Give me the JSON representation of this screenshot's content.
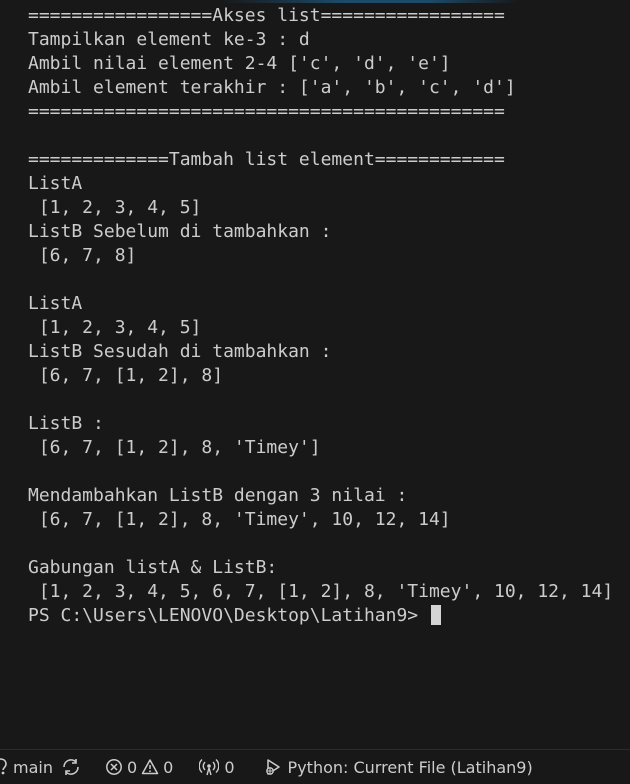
{
  "terminal": {
    "lines": [
      "=================Akses list=================",
      "Tampilkan element ke-3 : d",
      "Ambil nilai element 2-4 ['c', 'd', 'e']",
      "Ambil element terakhir : ['a', 'b', 'c', 'd']",
      "============================================",
      "",
      "=============Tambah list element============",
      "ListA",
      " [1, 2, 3, 4, 5]",
      "ListB Sebelum di tambahkan :",
      " [6, 7, 8]",
      "",
      "ListA",
      " [1, 2, 3, 4, 5]",
      "ListB Sesudah di tambahkan :",
      " [6, 7, [1, 2], 8]",
      "",
      "ListB :",
      " [6, 7, [1, 2], 8, 'Timey']",
      "",
      "Mendambahkan ListB dengan 3 nilai :",
      " [6, 7, [1, 2], 8, 'Timey', 10, 12, 14]",
      "",
      "Gabungan listA & ListB:",
      " [1, 2, 3, 4, 5, 6, 7, [1, 2], 8, 'Timey', 10, 12, 14]"
    ],
    "prompt": "PS C:\\Users\\LENOVO\\Desktop\\Latihan9> "
  },
  "statusbar": {
    "branch_icon": "git-branch-icon",
    "branch": "main",
    "sync_icon": "sync-icon",
    "errors_icon": "error-icon",
    "errors": "0",
    "warnings_icon": "warning-icon",
    "warnings": "0",
    "ports_icon": "broadcast-icon",
    "ports": "0",
    "debug_icon": "debug-icon",
    "debug_label": "Python: Current File (Latihan9)"
  },
  "colors": {
    "background": "#181818",
    "text": "#cccccc"
  }
}
